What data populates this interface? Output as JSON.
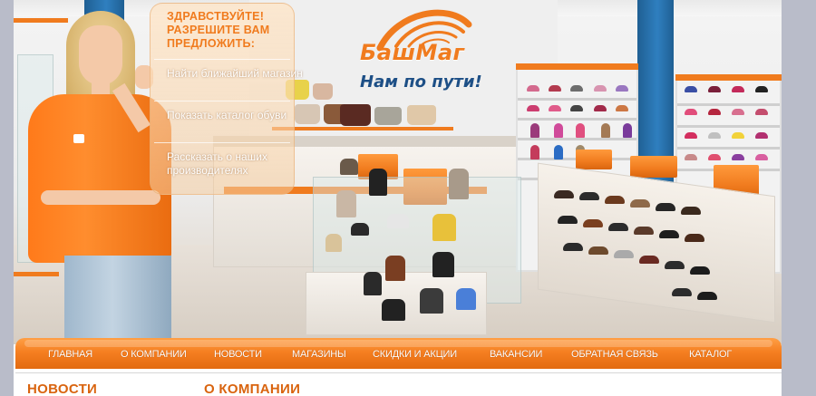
{
  "brand": {
    "name": "БашМаг",
    "slogan": "Нам по пути!",
    "color_orange": "#f07b1e",
    "color_blue": "#1d4f86"
  },
  "promo": {
    "title": "ЗДРАВСТВУЙТЕ! РАЗРЕШИТЕ ВАМ ПРЕДЛОЖИТЬ:",
    "links": [
      "Найти ближайший магазин",
      "Показать каталог обуви",
      "Рассказать о наших производителях"
    ]
  },
  "nav": {
    "items": [
      "ГЛАВНАЯ",
      "О КОМПАНИИ",
      "НОВОСТИ",
      "МАГАЗИНЫ",
      "СКИДКИ И АКЦИИ",
      "ВАКАНСИИ",
      "ОБРАТНАЯ СВЯЗЬ",
      "КАТАЛОГ"
    ]
  },
  "sections": {
    "news_title": "НОВОСТИ",
    "about_title": "О КОМПАНИИ"
  }
}
